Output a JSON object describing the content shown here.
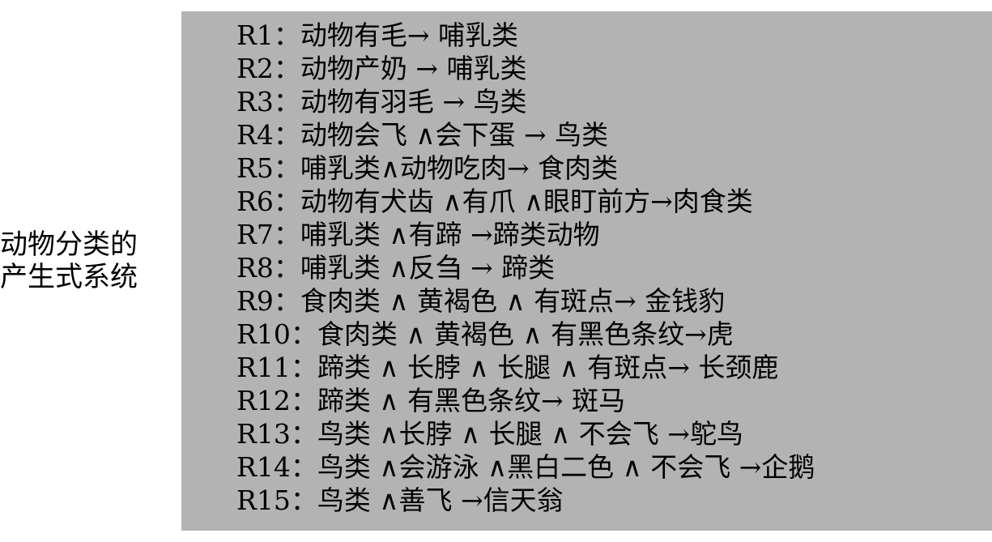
{
  "side_title": {
    "line1": "动物分类的",
    "line2": "产生式系统"
  },
  "rules": [
    {
      "id": "R1：",
      "text": "动物有毛→ 哺乳类"
    },
    {
      "id": "R2：",
      "text": "动物产奶 → 哺乳类"
    },
    {
      "id": "R3：",
      "text": "动物有羽毛 → 鸟类"
    },
    {
      "id": "R4：",
      "text": "动物会飞 ∧会下蛋 → 鸟类"
    },
    {
      "id": "R5：",
      "text": "哺乳类∧动物吃肉→ 食肉类"
    },
    {
      "id": "R6：",
      "text": "动物有犬齿 ∧有爪 ∧眼盯前方→肉食类"
    },
    {
      "id": "R7：",
      "text": "哺乳类 ∧有蹄 →蹄类动物"
    },
    {
      "id": "R8：",
      "text": "哺乳类 ∧反刍 → 蹄类"
    },
    {
      "id": "R9：",
      "text": "食肉类 ∧ 黄褐色 ∧ 有斑点→ 金钱豹"
    },
    {
      "id": "R10：",
      "text": "食肉类 ∧ 黄褐色 ∧ 有黑色条纹→虎"
    },
    {
      "id": "R11：",
      "text": "蹄类 ∧ 长脖 ∧ 长腿 ∧ 有斑点→ 长颈鹿"
    },
    {
      "id": "R12：",
      "text": "蹄类 ∧  有黑色条纹→ 斑马"
    },
    {
      "id": "R13：",
      "text": "鸟类 ∧长脖 ∧ 长腿 ∧ 不会飞 →鸵鸟"
    },
    {
      "id": "R14：",
      "text": "鸟类 ∧会游泳 ∧黑白二色 ∧ 不会飞 →企鹅"
    },
    {
      "id": "R15：",
      "text": "鸟类 ∧善飞 →信天翁"
    }
  ]
}
